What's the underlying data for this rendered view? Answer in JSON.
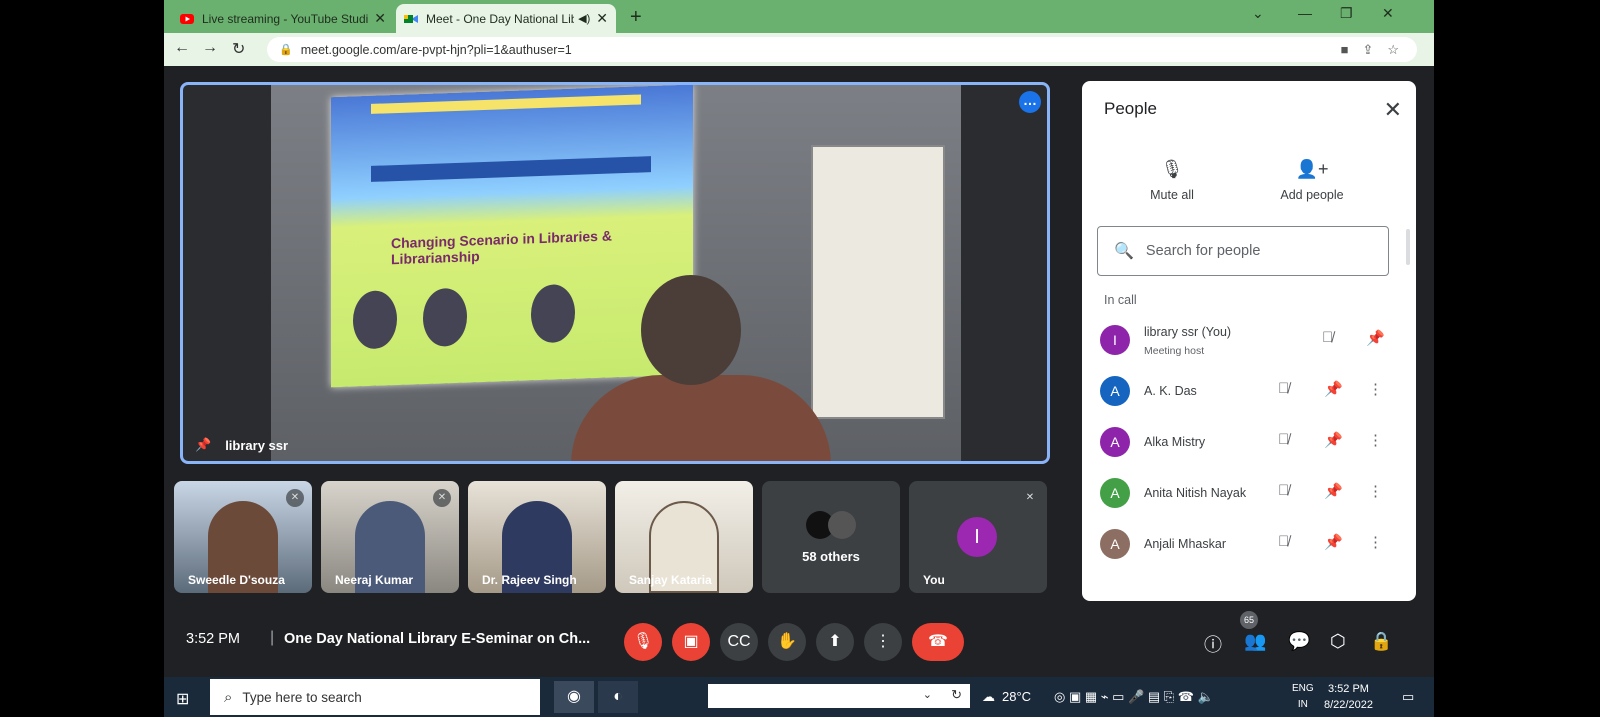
{
  "browser": {
    "tabs": [
      {
        "title": "Live streaming - YouTube Studio",
        "icon": "youtube-icon"
      },
      {
        "title": "Meet - One Day National Lib",
        "icon": "meet-icon",
        "active": true
      }
    ],
    "url": "meet.google.com/are-pvpt-hjn?pli=1&authuser=1"
  },
  "main_video": {
    "name": "library ssr",
    "slide_title": "Changing Scenario in Libraries & Librarianship"
  },
  "tiles": [
    {
      "name": "Sweedle D'souza"
    },
    {
      "name": "Neeraj Kumar"
    },
    {
      "name": "Dr. Rajeev Singh"
    },
    {
      "name": "Sanjay Kataria"
    },
    {
      "name": "58 others"
    },
    {
      "name": "You",
      "avatar": "I"
    }
  ],
  "people_panel": {
    "title": "People",
    "mute_all": "Mute all",
    "add_people": "Add people",
    "search_placeholder": "Search for people",
    "section": "In call",
    "participants": [
      {
        "name": "library ssr (You)",
        "role": "Meeting host",
        "initial": "I",
        "color": "#8e24aa"
      },
      {
        "name": "A. K. Das",
        "initial": "A",
        "color": "#1565c0"
      },
      {
        "name": "Alka Mistry",
        "initial": "A",
        "color": "#8e24aa"
      },
      {
        "name": "Anita Nitish Nayak",
        "initial": "A",
        "color": "#43a047"
      },
      {
        "name": "Anjali Mhaskar",
        "initial": "A",
        "color": "#8d6e63"
      }
    ]
  },
  "bottom_bar": {
    "time": "3:52 PM",
    "separator": "|",
    "meeting_title": "One Day National Library E-Seminar on Ch...",
    "participant_count": "65"
  },
  "taskbar": {
    "search_placeholder": "Type here to search",
    "temperature": "28°C",
    "lang_top": "ENG",
    "lang_bottom": "IN",
    "time": "3:52 PM",
    "date": "8/22/2022"
  }
}
